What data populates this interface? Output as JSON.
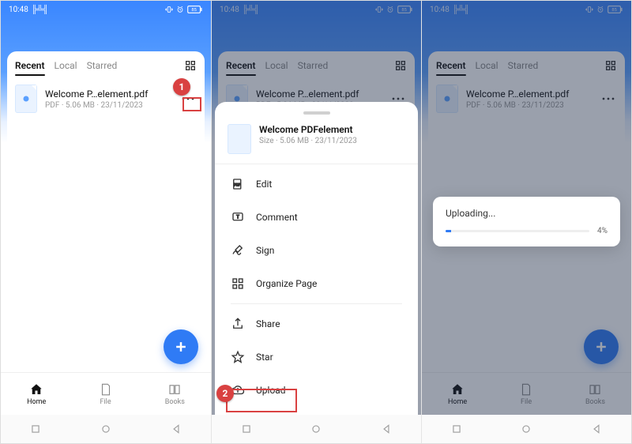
{
  "status": {
    "time": "10:48",
    "indicator": "╠╩╣",
    "battery": "85"
  },
  "header": {
    "title": "Home"
  },
  "tabs": {
    "recent": "Recent",
    "local": "Local",
    "starred": "Starred"
  },
  "file": {
    "name": "Welcome P…element.pdf",
    "meta": "PDF · 5.06 MB · 23/11/2023"
  },
  "nav": {
    "home": "Home",
    "file": "File",
    "books": "Books"
  },
  "sheet": {
    "title": "Welcome PDFelement",
    "sub": "Size · 5.06 MB · 23/11/2023",
    "items": {
      "edit": "Edit",
      "comment": "Comment",
      "sign": "Sign",
      "organize": "Organize Page",
      "share": "Share",
      "star": "Star",
      "upload": "Upload"
    }
  },
  "upload": {
    "label": "Uploading...",
    "percent": "4%",
    "value": 4
  },
  "callouts": {
    "one": "1",
    "two": "2"
  }
}
